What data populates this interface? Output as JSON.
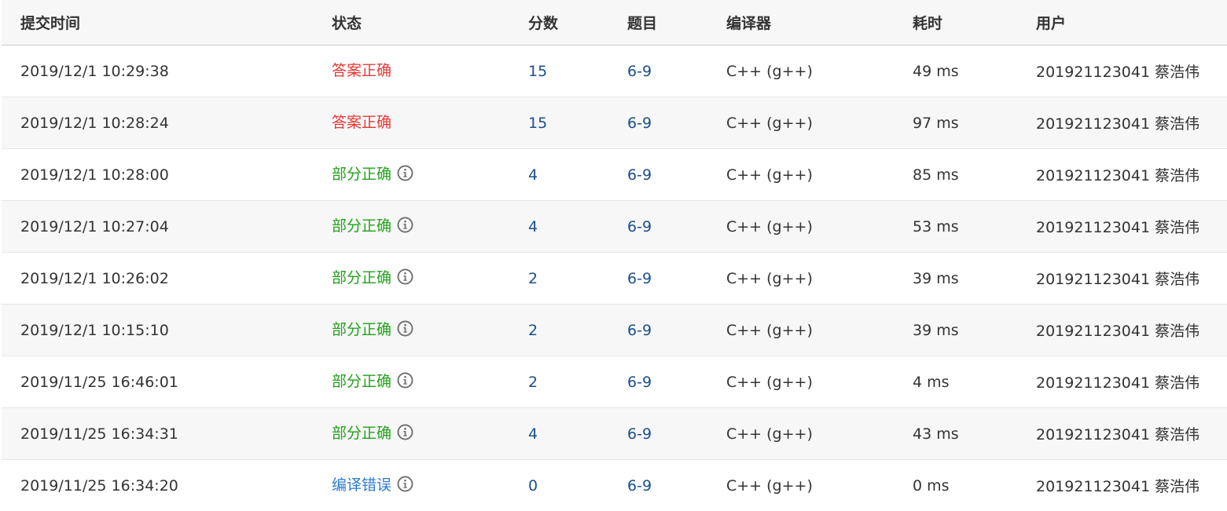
{
  "columns": {
    "time": "提交时间",
    "status": "状态",
    "score": "分数",
    "problem": "题目",
    "compiler": "编译器",
    "cost": "耗时",
    "user": "用户"
  },
  "colors": {
    "accepted": "#e53935",
    "partial": "#23a11b",
    "compile_error": "#2d7bd1",
    "link": "#1a4f8f"
  },
  "rows": [
    {
      "time": "2019/12/1 10:29:38",
      "status": "答案正确",
      "status_type": "accepted",
      "score": "15",
      "problem": "6-9",
      "compiler": "C++ (g++)",
      "cost": "49 ms",
      "user": "201921123041 蔡浩伟",
      "info": false
    },
    {
      "time": "2019/12/1 10:28:24",
      "status": "答案正确",
      "status_type": "accepted",
      "score": "15",
      "problem": "6-9",
      "compiler": "C++ (g++)",
      "cost": "97 ms",
      "user": "201921123041 蔡浩伟",
      "info": false
    },
    {
      "time": "2019/12/1 10:28:00",
      "status": "部分正确",
      "status_type": "partial",
      "score": "4",
      "problem": "6-9",
      "compiler": "C++ (g++)",
      "cost": "85 ms",
      "user": "201921123041 蔡浩伟",
      "info": true
    },
    {
      "time": "2019/12/1 10:27:04",
      "status": "部分正确",
      "status_type": "partial",
      "score": "4",
      "problem": "6-9",
      "compiler": "C++ (g++)",
      "cost": "53 ms",
      "user": "201921123041 蔡浩伟",
      "info": true
    },
    {
      "time": "2019/12/1 10:26:02",
      "status": "部分正确",
      "status_type": "partial",
      "score": "2",
      "problem": "6-9",
      "compiler": "C++ (g++)",
      "cost": "39 ms",
      "user": "201921123041 蔡浩伟",
      "info": true
    },
    {
      "time": "2019/12/1 10:15:10",
      "status": "部分正确",
      "status_type": "partial",
      "score": "2",
      "problem": "6-9",
      "compiler": "C++ (g++)",
      "cost": "39 ms",
      "user": "201921123041 蔡浩伟",
      "info": true
    },
    {
      "time": "2019/11/25 16:46:01",
      "status": "部分正确",
      "status_type": "partial",
      "score": "2",
      "problem": "6-9",
      "compiler": "C++ (g++)",
      "cost": "4 ms",
      "user": "201921123041 蔡浩伟",
      "info": true
    },
    {
      "time": "2019/11/25 16:34:31",
      "status": "部分正确",
      "status_type": "partial",
      "score": "4",
      "problem": "6-9",
      "compiler": "C++ (g++)",
      "cost": "43 ms",
      "user": "201921123041 蔡浩伟",
      "info": true
    },
    {
      "time": "2019/11/25 16:34:20",
      "status": "编译错误",
      "status_type": "compile_error",
      "score": "0",
      "problem": "6-9",
      "compiler": "C++ (g++)",
      "cost": "0 ms",
      "user": "201921123041 蔡浩伟",
      "info": true
    }
  ],
  "icons": {
    "info": "info-circle-icon"
  }
}
